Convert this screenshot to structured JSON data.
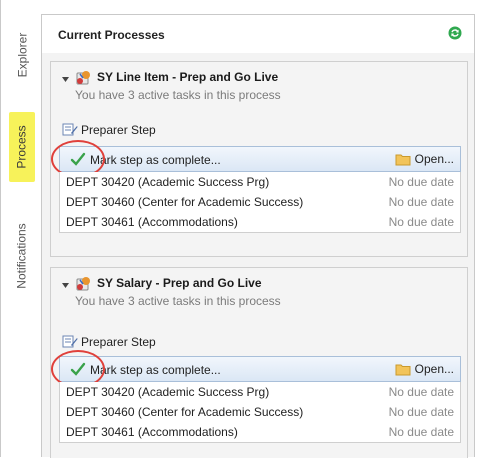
{
  "tabs": [
    {
      "label": "Explorer"
    },
    {
      "label": "Process"
    },
    {
      "label": "Notifications"
    }
  ],
  "panel": {
    "title": "Current Processes"
  },
  "processes": [
    {
      "title": "SY Line Item - Prep and Go Live",
      "subtitle": "You have 3 active tasks in this process",
      "step": "Preparer Step",
      "action": "Mark step as complete...",
      "open_label": "Open...",
      "tasks": [
        {
          "name": "DEPT 30420 (Academic Success Prg)",
          "due": "No due date"
        },
        {
          "name": "DEPT 30460 (Center for Academic Success)",
          "due": "No due date"
        },
        {
          "name": "DEPT 30461 (Accommodations)",
          "due": "No due date"
        }
      ]
    },
    {
      "title": "SY Salary - Prep and Go Live",
      "subtitle": "You have 3 active tasks in this process",
      "step": "Preparer Step",
      "action": "Mark step as complete...",
      "open_label": "Open...",
      "tasks": [
        {
          "name": "DEPT 30420 (Academic Success Prg)",
          "due": "No due date"
        },
        {
          "name": "DEPT 30460 (Center for Academic Success)",
          "due": "No due date"
        },
        {
          "name": "DEPT 30461 (Accommodations)",
          "due": "No due date"
        }
      ]
    }
  ],
  "colors": {
    "tab_highlight": "#f7f25a",
    "action_bar": "#dbe7f5",
    "callout_ring": "#e0403a",
    "check": "#3aa24a",
    "refresh": "#2fa84f"
  }
}
